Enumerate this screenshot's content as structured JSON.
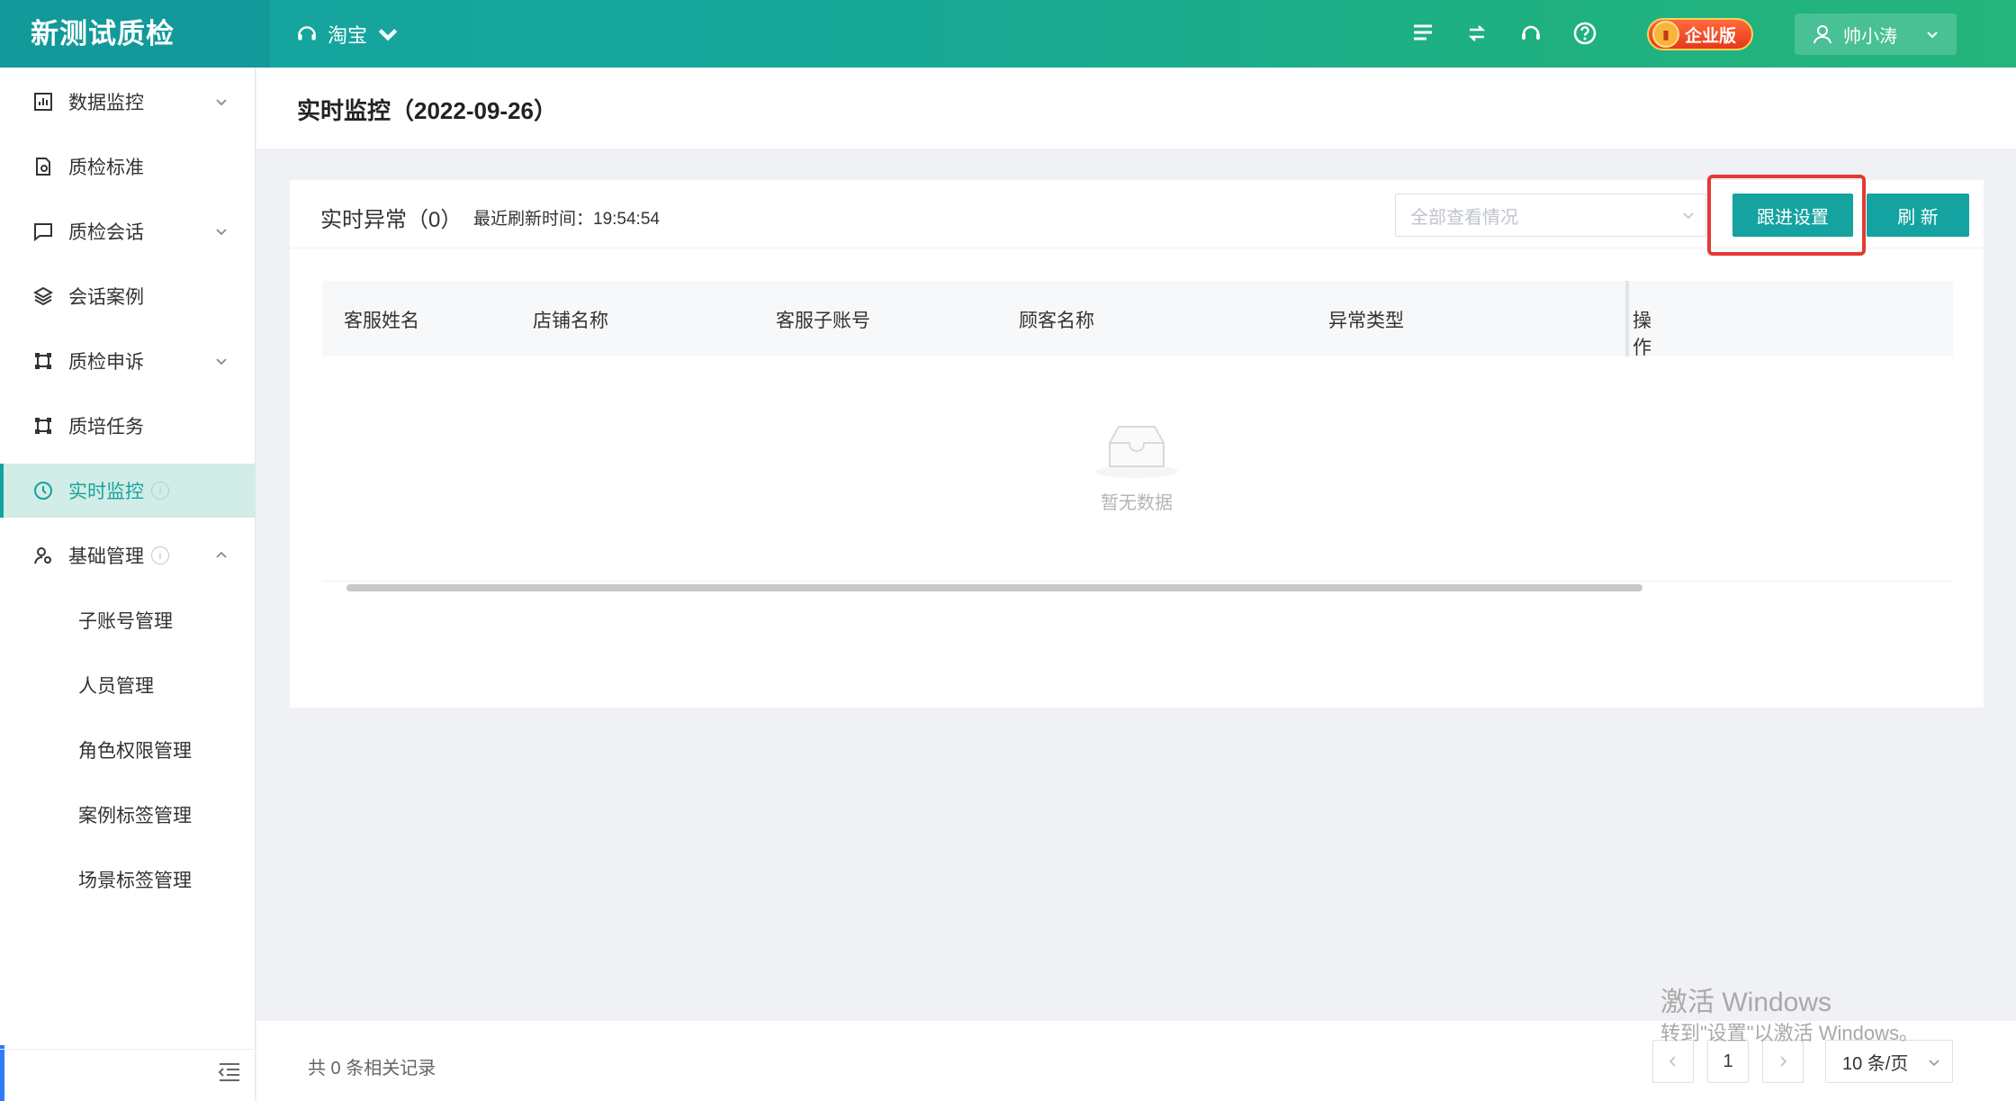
{
  "app": {
    "brand": "新测试质检",
    "shop": "淘宝",
    "enterprise_badge": "企业版",
    "user_name": "帅小涛"
  },
  "sidebar": {
    "items": [
      {
        "label": "数据监控",
        "icon": "bar-chart-icon",
        "expandable": true
      },
      {
        "label": "质检标准",
        "icon": "document-icon"
      },
      {
        "label": "质检会话",
        "icon": "chat-icon",
        "expandable": true
      },
      {
        "label": "会话案例",
        "icon": "layers-icon"
      },
      {
        "label": "质检申诉",
        "icon": "frame-icon",
        "expandable": true
      },
      {
        "label": "质培任务",
        "icon": "frame-icon"
      },
      {
        "label": "实时监控",
        "icon": "clock-icon",
        "active": true
      },
      {
        "label": "基础管理",
        "icon": "user-settings-icon",
        "expanded": true
      }
    ],
    "sub_items": [
      "子账号管理",
      "人员管理",
      "角色权限管理",
      "案例标签管理",
      "场景标签管理"
    ],
    "info_mark": "i"
  },
  "page": {
    "title": "实时监控（2022-09-26）"
  },
  "card": {
    "title": "实时异常（0）",
    "refresh_time": "最近刷新时间：19:54:54",
    "select_placeholder": "全部查看情况",
    "follow_button": "跟进设置",
    "refresh_button": "刷 新"
  },
  "table": {
    "columns": [
      "客服姓名",
      "店铺名称",
      "客服子账号",
      "顾客名称",
      "异常类型",
      "操作"
    ],
    "rows": [],
    "empty_text": "暂无数据"
  },
  "footer": {
    "total": "共 0 条相关记录",
    "current_page": "1",
    "page_size": "10 条/页"
  },
  "watermark": {
    "line1": "激活 Windows",
    "line2": "转到\"设置\"以激活 Windows。"
  },
  "colors": {
    "primary": "#14a3a0",
    "header_gradient_end": "#23b57c",
    "highlight": "#e53935",
    "active_bg": "#d2ece8"
  }
}
